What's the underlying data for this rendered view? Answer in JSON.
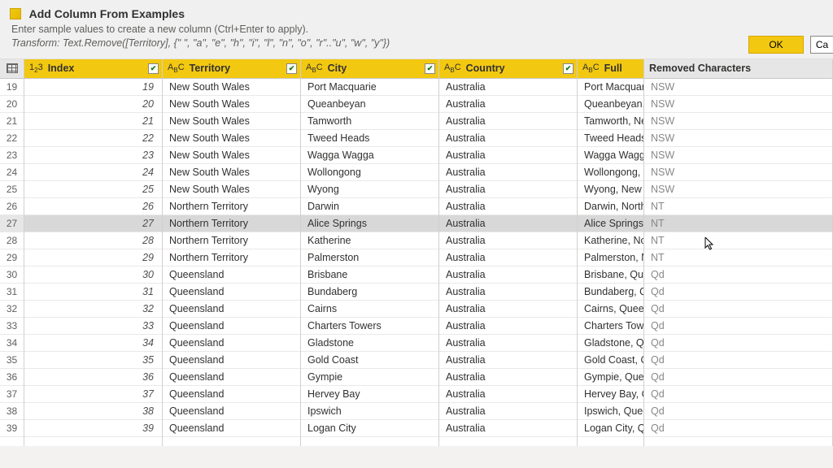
{
  "header": {
    "title": "Add Column From Examples",
    "subtitle": "Enter sample values to create a new column (Ctrl+Enter to apply).",
    "formula": "Transform: Text.Remove([Territory], {\" \", \"a\", \"e\", \"h\", \"i\", \"l\", \"n\", \"o\", \"r\"..\"u\", \"w\", \"y\"})",
    "ok_label": "OK",
    "cancel_label": "Ca"
  },
  "columns": {
    "index": "Index",
    "territory": "Territory",
    "city": "City",
    "country": "Country",
    "full": "Full",
    "removed": "Removed Characters"
  },
  "type_icons": {
    "number": "1²₃",
    "text_abc": "AᴮC"
  },
  "selected_row": 27,
  "rows": [
    {
      "n": 19,
      "idx": 19,
      "territory": "New South Wales",
      "city": "Port Macquarie",
      "country": "Australia",
      "full": "Port Macquari",
      "removed": "NSW"
    },
    {
      "n": 20,
      "idx": 20,
      "territory": "New South Wales",
      "city": "Queanbeyan",
      "country": "Australia",
      "full": "Queanbeyan, N",
      "removed": "NSW"
    },
    {
      "n": 21,
      "idx": 21,
      "territory": "New South Wales",
      "city": "Tamworth",
      "country": "Australia",
      "full": "Tamworth, Ne",
      "removed": "NSW"
    },
    {
      "n": 22,
      "idx": 22,
      "territory": "New South Wales",
      "city": "Tweed Heads",
      "country": "Australia",
      "full": "Tweed Heads,",
      "removed": "NSW"
    },
    {
      "n": 23,
      "idx": 23,
      "territory": "New South Wales",
      "city": "Wagga Wagga",
      "country": "Australia",
      "full": "Wagga Wagga,",
      "removed": "NSW"
    },
    {
      "n": 24,
      "idx": 24,
      "territory": "New South Wales",
      "city": "Wollongong",
      "country": "Australia",
      "full": "Wollongong, N",
      "removed": "NSW"
    },
    {
      "n": 25,
      "idx": 25,
      "territory": "New South Wales",
      "city": "Wyong",
      "country": "Australia",
      "full": "Wyong, New S",
      "removed": "NSW"
    },
    {
      "n": 26,
      "idx": 26,
      "territory": "Northern Territory",
      "city": "Darwin",
      "country": "Australia",
      "full": "Darwin, Northe",
      "removed": "NT"
    },
    {
      "n": 27,
      "idx": 27,
      "territory": "Northern Territory",
      "city": "Alice Springs",
      "country": "Australia",
      "full": "Alice Springs, N",
      "removed": "NT"
    },
    {
      "n": 28,
      "idx": 28,
      "territory": "Northern Territory",
      "city": "Katherine",
      "country": "Australia",
      "full": "Katherine, Nor",
      "removed": "NT"
    },
    {
      "n": 29,
      "idx": 29,
      "territory": "Northern Territory",
      "city": "Palmerston",
      "country": "Australia",
      "full": "Palmerston, Ne",
      "removed": "NT"
    },
    {
      "n": 30,
      "idx": 30,
      "territory": "Queensland",
      "city": "Brisbane",
      "country": "Australia",
      "full": "Brisbane, Quee",
      "removed": "Qd"
    },
    {
      "n": 31,
      "idx": 31,
      "territory": "Queensland",
      "city": "Bundaberg",
      "country": "Australia",
      "full": "Bundaberg, Qu",
      "removed": "Qd"
    },
    {
      "n": 32,
      "idx": 32,
      "territory": "Queensland",
      "city": "Cairns",
      "country": "Australia",
      "full": "Cairns, Queens",
      "removed": "Qd"
    },
    {
      "n": 33,
      "idx": 33,
      "territory": "Queensland",
      "city": "Charters Towers",
      "country": "Australia",
      "full": "Charters Towe",
      "removed": "Qd"
    },
    {
      "n": 34,
      "idx": 34,
      "territory": "Queensland",
      "city": "Gladstone",
      "country": "Australia",
      "full": "Gladstone, Qu",
      "removed": "Qd"
    },
    {
      "n": 35,
      "idx": 35,
      "territory": "Queensland",
      "city": "Gold Coast",
      "country": "Australia",
      "full": "Gold Coast, Qu",
      "removed": "Qd"
    },
    {
      "n": 36,
      "idx": 36,
      "territory": "Queensland",
      "city": "Gympie",
      "country": "Australia",
      "full": "Gympie, Quee",
      "removed": "Qd"
    },
    {
      "n": 37,
      "idx": 37,
      "territory": "Queensland",
      "city": "Hervey Bay",
      "country": "Australia",
      "full": "Hervey Bay, Qu",
      "removed": "Qd"
    },
    {
      "n": 38,
      "idx": 38,
      "territory": "Queensland",
      "city": "Ipswich",
      "country": "Australia",
      "full": "Ipswich, Queer",
      "removed": "Qd"
    },
    {
      "n": 39,
      "idx": 39,
      "territory": "Queensland",
      "city": "Logan City",
      "country": "Australia",
      "full": "Logan City, Qu",
      "removed": "Qd"
    }
  ]
}
